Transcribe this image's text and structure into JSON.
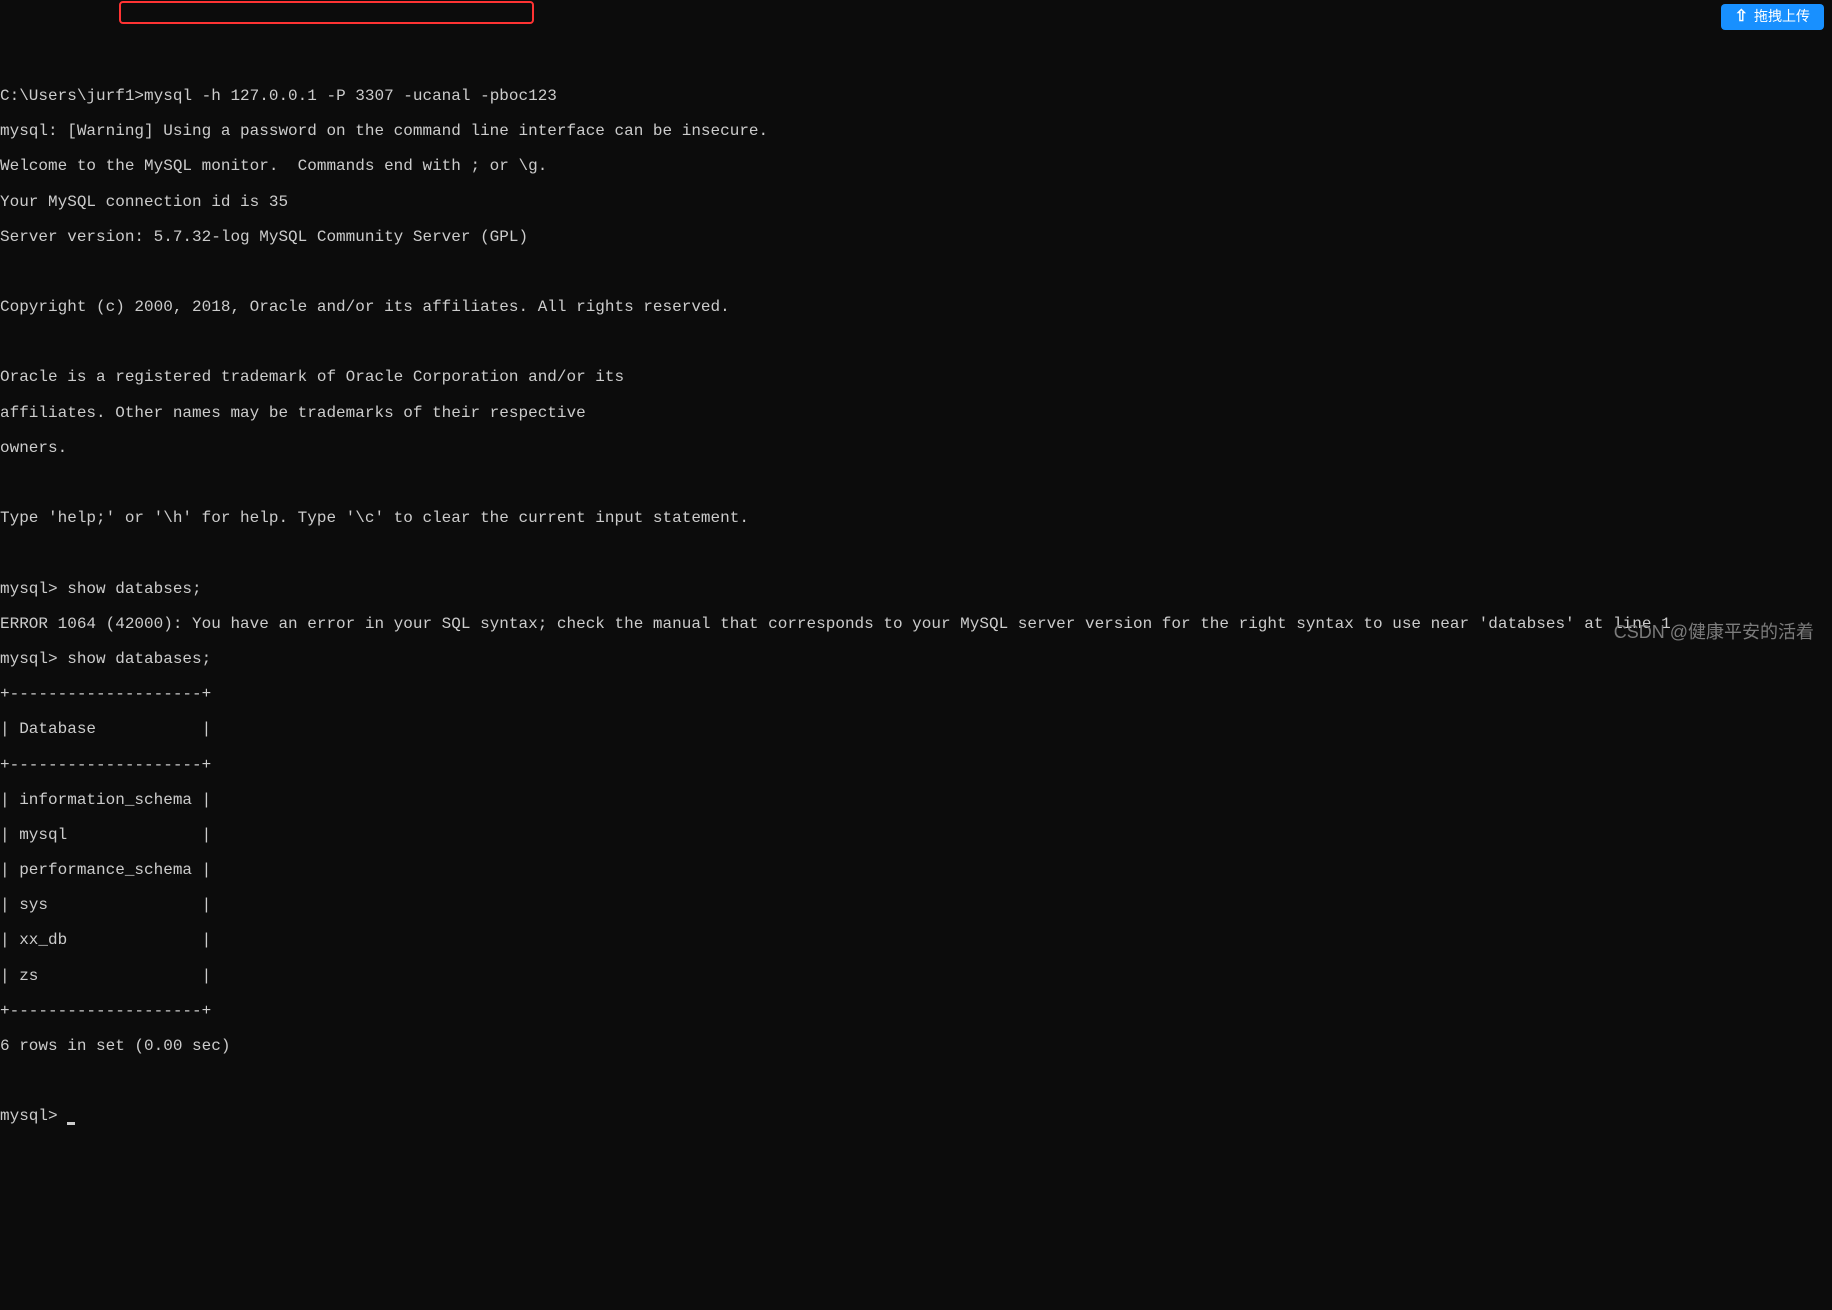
{
  "prompt_path": "C:\\Users\\jurf1>",
  "command": "mysql -h 127.0.0.1 -P 3307 -ucanal -pboc123",
  "lines": {
    "warning": "mysql: [Warning] Using a password on the command line interface can be insecure.",
    "welcome": "Welcome to the MySQL monitor.  Commands end with ; or \\g.",
    "conn_id": "Your MySQL connection id is 35",
    "version": "Server version: 5.7.32-log MySQL Community Server (GPL)",
    "copyright": "Copyright (c) 2000, 2018, Oracle and/or its affiliates. All rights reserved.",
    "trademark1": "Oracle is a registered trademark of Oracle Corporation and/or its",
    "trademark2": "affiliates. Other names may be trademarks of their respective",
    "trademark3": "owners.",
    "help": "Type 'help;' or '\\h' for help. Type '\\c' to clear the current input statement.",
    "cmd1": "mysql> show databses;",
    "error": "ERROR 1064 (42000): You have an error in your SQL syntax; check the manual that corresponds to your MySQL server version for the right syntax to use near 'databses' at line 1",
    "cmd2": "mysql> show databases;",
    "sep": "+--------------------+",
    "header": "| Database           |",
    "rows": {
      "r1": "| information_schema |",
      "r2": "| mysql              |",
      "r3": "| performance_schema |",
      "r4": "| sys                |",
      "r5": "| xx_db              |",
      "r6": "| zs                 |"
    },
    "summary": "6 rows in set (0.00 sec)",
    "prompt": "mysql> "
  },
  "watermark": "CSDN @健康平安的活着",
  "upload_button": "拖拽上传"
}
